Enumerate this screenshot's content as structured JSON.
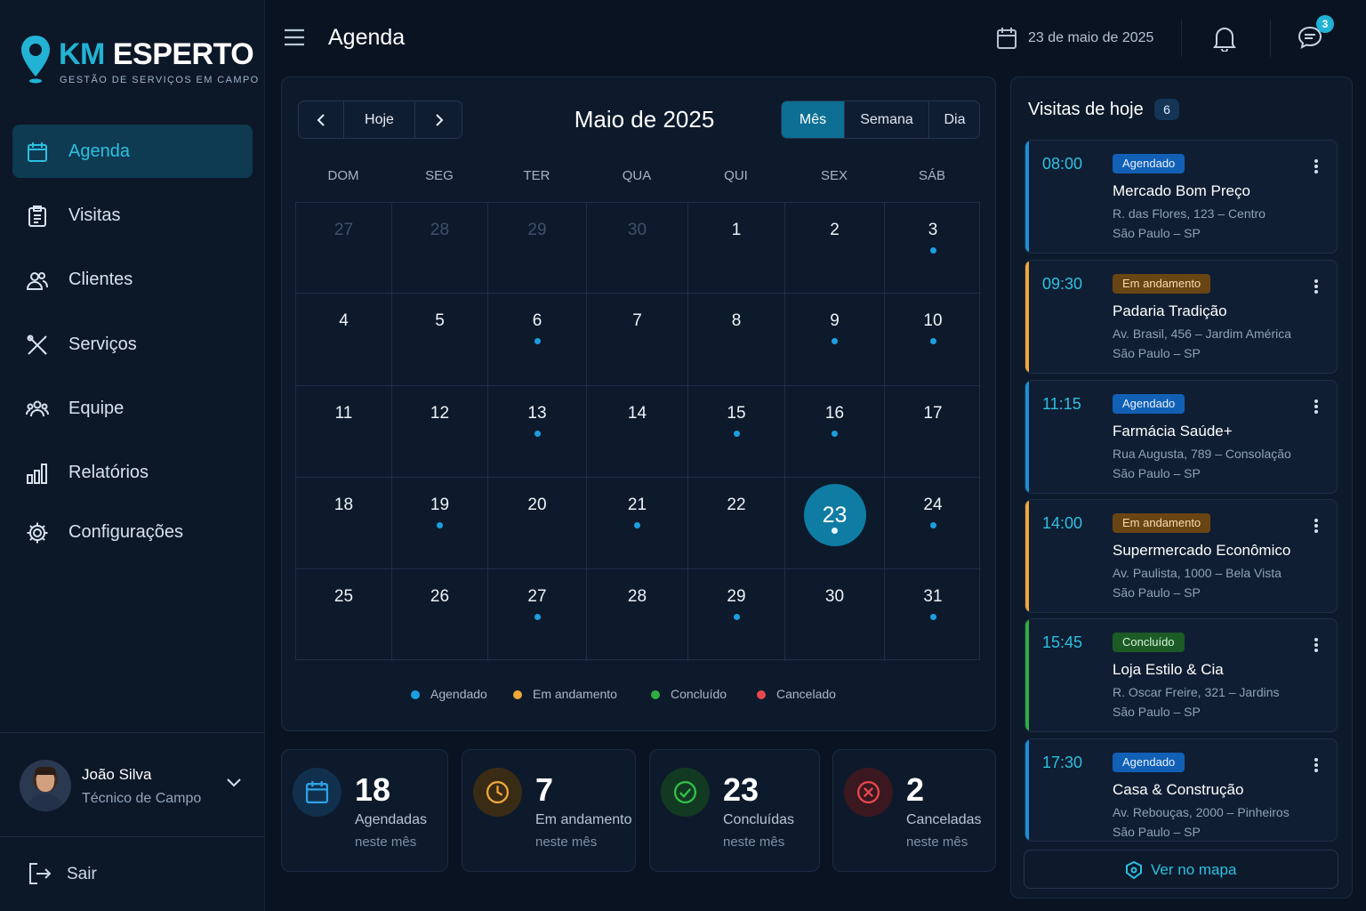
{
  "brand": {
    "name_part1": "KM",
    "name_part2": "ESPERTO",
    "tagline": "GESTÃO DE SERVIÇOS EM CAMPO"
  },
  "colors": {
    "accent": "#22b3d4",
    "scheduled": "#1c9fe0",
    "in_progress": "#f0a73a",
    "completed": "#2fae3f",
    "cancelled": "#e5484d"
  },
  "sidebar": {
    "items": [
      {
        "label": "Agenda",
        "icon": "calendar-icon",
        "active": true
      },
      {
        "label": "Visitas",
        "icon": "clipboard-icon",
        "active": false
      },
      {
        "label": "Clientes",
        "icon": "users-icon",
        "active": false
      },
      {
        "label": "Serviços",
        "icon": "tools-icon",
        "active": false
      },
      {
        "label": "Equipe",
        "icon": "team-icon",
        "active": false
      },
      {
        "label": "Relatórios",
        "icon": "bar-chart-icon",
        "active": false
      },
      {
        "label": "Configurações",
        "icon": "gear-icon",
        "active": false
      }
    ],
    "user": {
      "name": "João Silva",
      "role": "Técnico de Campo"
    },
    "logout_label": "Sair"
  },
  "header": {
    "title": "Agenda",
    "date": "23 de maio de 2025",
    "messages_badge": "3"
  },
  "calendar": {
    "today_label": "Hoje",
    "month_title": "Maio de 2025",
    "views": [
      "Mês",
      "Semana",
      "Dia"
    ],
    "active_view": "Mês",
    "weekdays": [
      "DOM",
      "SEG",
      "TER",
      "QUA",
      "QUI",
      "SEX",
      "SÁB"
    ],
    "days": [
      {
        "n": "27",
        "muted": true,
        "dot": false
      },
      {
        "n": "28",
        "muted": true,
        "dot": false
      },
      {
        "n": "29",
        "muted": true,
        "dot": false
      },
      {
        "n": "30",
        "muted": true,
        "dot": false
      },
      {
        "n": "1",
        "muted": false,
        "dot": false
      },
      {
        "n": "2",
        "muted": false,
        "dot": false
      },
      {
        "n": "3",
        "muted": false,
        "dot": true
      },
      {
        "n": "4",
        "muted": false,
        "dot": false
      },
      {
        "n": "5",
        "muted": false,
        "dot": false
      },
      {
        "n": "6",
        "muted": false,
        "dot": true
      },
      {
        "n": "7",
        "muted": false,
        "dot": false
      },
      {
        "n": "8",
        "muted": false,
        "dot": false
      },
      {
        "n": "9",
        "muted": false,
        "dot": true
      },
      {
        "n": "10",
        "muted": false,
        "dot": true
      },
      {
        "n": "11",
        "muted": false,
        "dot": false
      },
      {
        "n": "12",
        "muted": false,
        "dot": false
      },
      {
        "n": "13",
        "muted": false,
        "dot": true
      },
      {
        "n": "14",
        "muted": false,
        "dot": false
      },
      {
        "n": "15",
        "muted": false,
        "dot": true
      },
      {
        "n": "16",
        "muted": false,
        "dot": true
      },
      {
        "n": "17",
        "muted": false,
        "dot": false
      },
      {
        "n": "18",
        "muted": false,
        "dot": false
      },
      {
        "n": "19",
        "muted": false,
        "dot": true
      },
      {
        "n": "20",
        "muted": false,
        "dot": false
      },
      {
        "n": "21",
        "muted": false,
        "dot": true
      },
      {
        "n": "22",
        "muted": false,
        "dot": false
      },
      {
        "n": "23",
        "muted": false,
        "dot": true,
        "today": true
      },
      {
        "n": "24",
        "muted": false,
        "dot": true
      },
      {
        "n": "25",
        "muted": false,
        "dot": false
      },
      {
        "n": "26",
        "muted": false,
        "dot": false
      },
      {
        "n": "27",
        "muted": false,
        "dot": true
      },
      {
        "n": "28",
        "muted": false,
        "dot": false
      },
      {
        "n": "29",
        "muted": false,
        "dot": true
      },
      {
        "n": "30",
        "muted": false,
        "dot": false
      },
      {
        "n": "31",
        "muted": false,
        "dot": true
      }
    ],
    "legend": [
      {
        "label": "Agendado",
        "color": "#1c9fe0"
      },
      {
        "label": "Em andamento",
        "color": "#f0a73a"
      },
      {
        "label": "Concluído",
        "color": "#2fae3f"
      },
      {
        "label": "Cancelado",
        "color": "#e5484d"
      }
    ]
  },
  "stats": [
    {
      "value": "18",
      "label": "Agendadas",
      "sub": "neste mês",
      "icon": "calendar-icon"
    },
    {
      "value": "7",
      "label": "Em andamento",
      "sub": "neste mês",
      "icon": "clock-icon"
    },
    {
      "value": "23",
      "label": "Concluídas",
      "sub": "neste mês",
      "icon": "check-circle-icon"
    },
    {
      "value": "2",
      "label": "Canceladas",
      "sub": "neste mês",
      "icon": "x-circle-icon"
    }
  ],
  "visits": {
    "title": "Visitas de hoje",
    "count": "6",
    "items": [
      {
        "time": "08:00",
        "status": "Agendado",
        "name": "Mercado Bom Preço",
        "address": "R. das Flores, 123 – Centro",
        "city": "São Paulo – SP"
      },
      {
        "time": "09:30",
        "status": "Em andamento",
        "name": "Padaria Tradição",
        "address": "Av. Brasil, 456 – Jardim América",
        "city": "São Paulo – SP"
      },
      {
        "time": "11:15",
        "status": "Agendado",
        "name": "Farmácia Saúde+",
        "address": "Rua Augusta, 789 – Consolação",
        "city": "São Paulo – SP"
      },
      {
        "time": "14:00",
        "status": "Em andamento",
        "name": "Supermercado Econômico",
        "address": "Av. Paulista, 1000 – Bela Vista",
        "city": "São Paulo – SP"
      },
      {
        "time": "15:45",
        "status": "Concluído",
        "name": "Loja Estilo & Cia",
        "address": "R. Oscar Freire, 321 – Jardins",
        "city": "São Paulo – SP"
      },
      {
        "time": "17:30",
        "status": "Agendado",
        "name": "Casa & Construção",
        "address": "Av. Rebouças, 2000 – Pinheiros",
        "city": "São Paulo – SP"
      }
    ],
    "map_label": "Ver no mapa"
  }
}
